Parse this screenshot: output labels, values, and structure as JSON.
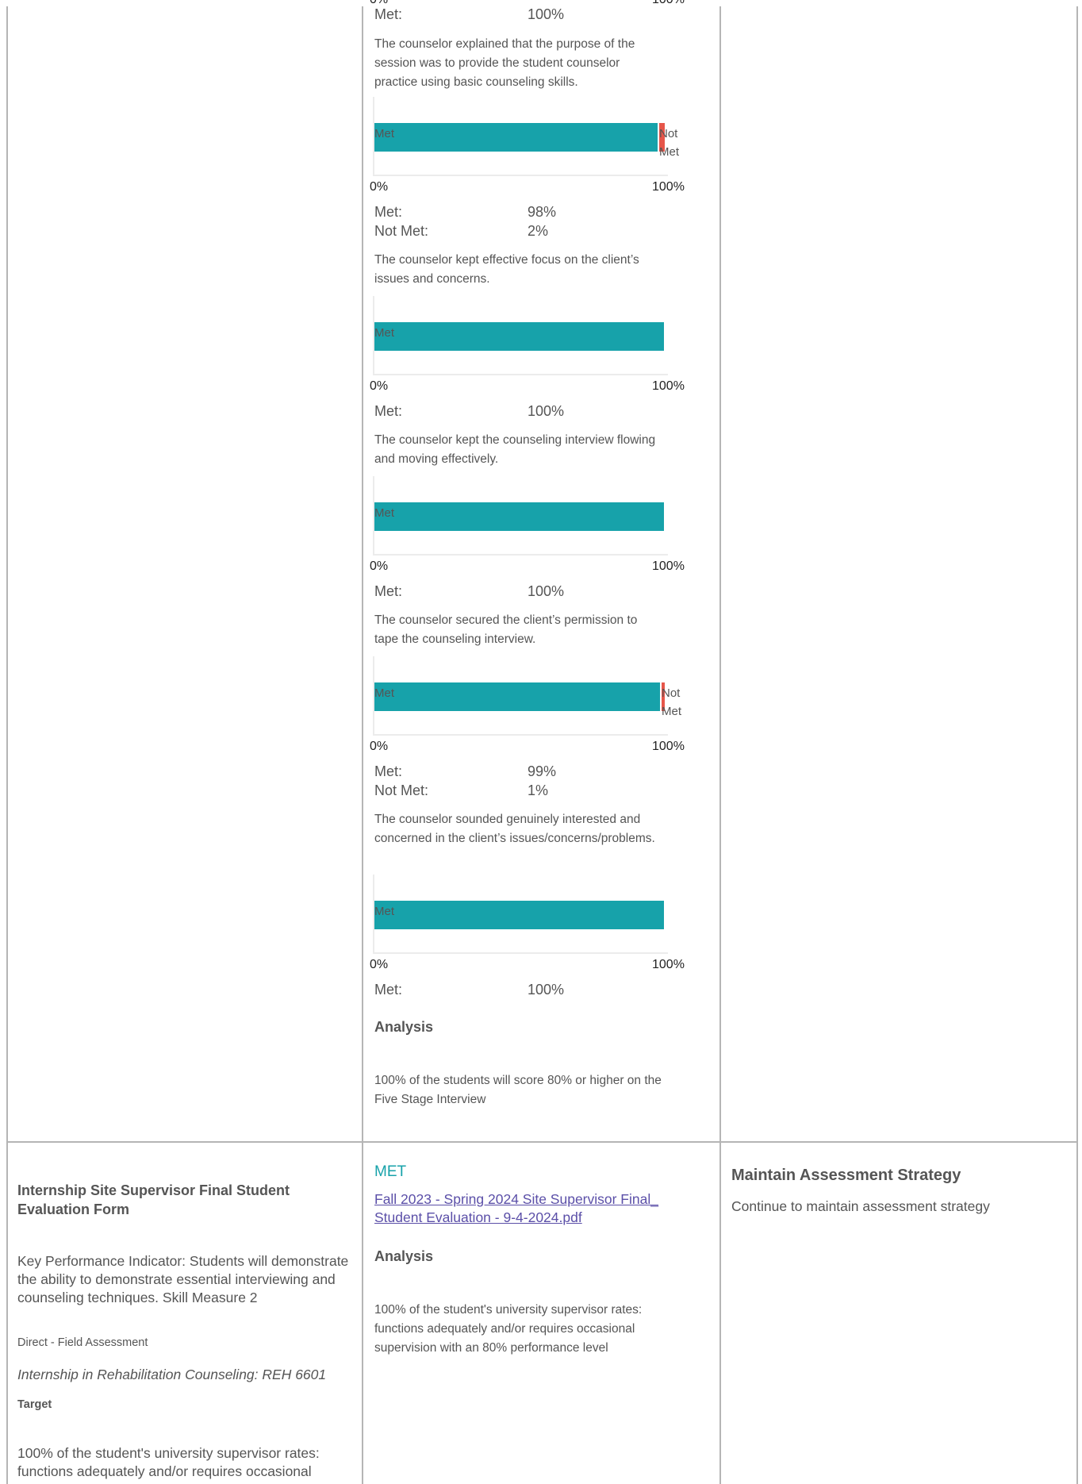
{
  "colors": {
    "met": "#17a2aa",
    "not_met": "#e6564a",
    "met_status": "#17a2aa",
    "link": "#5b4fa8",
    "grid": "#b5b5b5"
  },
  "top": {
    "axis_left": "0%",
    "axis_right": "100%",
    "met_label": "Met:",
    "met_value": "100%"
  },
  "questions": [
    {
      "text": "The counselor explained that the purpose of the session was to provide the student counselor practice using basic counseling skills.",
      "met_pct": 98,
      "not_met_pct": 2,
      "seg_met": "Met",
      "seg_not_met": "Not Met",
      "axis_left": "0%",
      "axis_right": "100%",
      "met_label": "Met:",
      "met_value": "98%",
      "not_met_label": "Not Met:",
      "not_met_value": "2%"
    },
    {
      "text": "The counselor kept effective focus on the client’s issues and concerns.",
      "met_pct": 100,
      "seg_met": "Met",
      "axis_left": "0%",
      "axis_right": "100%",
      "met_label": "Met:",
      "met_value": "100%"
    },
    {
      "text": "The counselor kept the counseling interview flowing and moving effectively.",
      "met_pct": 100,
      "seg_met": "Met",
      "axis_left": "0%",
      "axis_right": "100%",
      "met_label": "Met:",
      "met_value": "100%"
    },
    {
      "text": "The counselor secured the client’s permission to tape the counseling interview.",
      "met_pct": 99,
      "not_met_pct": 1,
      "seg_met": "Met",
      "seg_not_met": "Not Met",
      "axis_left": "0%",
      "axis_right": "100%",
      "met_label": "Met:",
      "met_value": "99%",
      "not_met_label": "Not Met:",
      "not_met_value": "1%"
    },
    {
      "text": "The counselor sounded genuinely interested and concerned in the client’s issues/concerns/problems.",
      "met_pct": 100,
      "seg_met": "Met",
      "axis_left": "0%",
      "axis_right": "100%",
      "met_label": "Met:",
      "met_value": "100%"
    }
  ],
  "analysis_top": {
    "heading": "Analysis",
    "text": "100% of the students will score 80% or higher on the Five Stage Interview"
  },
  "row2": {
    "measure_title": "Internship Site Supervisor Final Student Evaluation Form",
    "kpi": "Key Performance Indicator: Students will demonstrate the ability to demonstrate essential interviewing and counseling techniques. Skill Measure 2",
    "method": "Direct - Field Assessment",
    "course": "Internship in Rehabilitation Counseling: REH 6601",
    "target_heading": "Target",
    "target_text": "100% of the student's university supervisor rates: functions adequately and/or requires occasional",
    "status": "MET",
    "file_link": "Fall 2023 - Spring 2024 Site Supervisor Final_ Student Evaluation - 9-4-2024.pdf",
    "analysis_heading": "Analysis",
    "analysis_text": "100% of the student's university supervisor rates: functions adequately and/or requires occasional supervision with an 80% performance level",
    "action_heading": "Maintain Assessment Strategy",
    "action_text": "Continue to maintain assessment strategy"
  }
}
